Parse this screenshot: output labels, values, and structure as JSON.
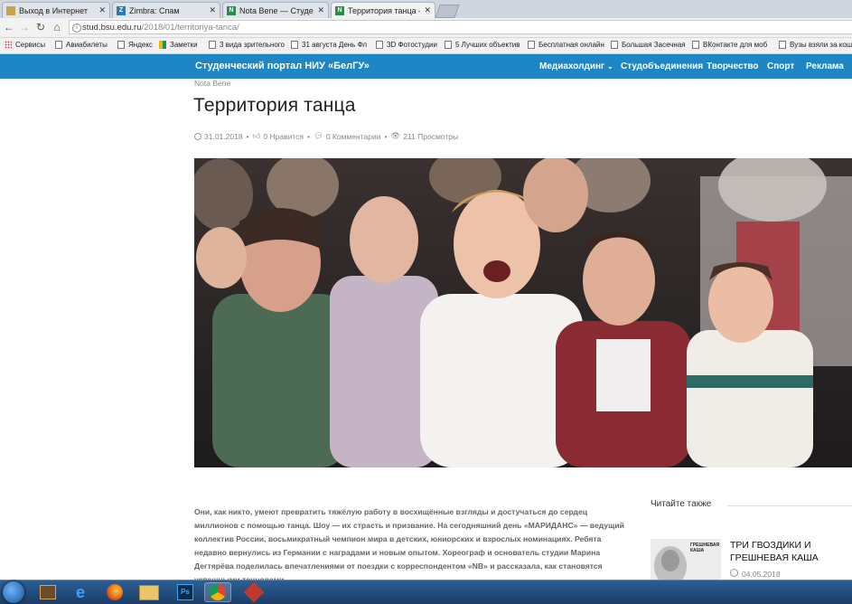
{
  "browser": {
    "tabs": [
      {
        "title": "Выход в Интернет",
        "favicon_color": "#c8a24a",
        "favicon_glyph": "",
        "active": false
      },
      {
        "title": "Zimbra: Спам",
        "favicon_color": "#2a7ab8",
        "favicon_glyph": "Z",
        "active": false
      },
      {
        "title": "Nota Bene — Студенческ",
        "favicon_color": "#2c8b4f",
        "favicon_glyph": "N",
        "active": false
      },
      {
        "title": "Территория танца — Сту",
        "favicon_color": "#2c8b4f",
        "favicon_glyph": "N",
        "active": true
      }
    ],
    "url_host": "stud.bsu.edu.ru",
    "url_path": "/2018/01/territoriya-tanca/",
    "bookmarks": [
      "Сервисы",
      "Авиабилеты",
      "Яндекс",
      "Заметки",
      "3 вида зрительного",
      "31 августа День Фл",
      "3D Фотостудии",
      "5 Лучших объектив",
      "Бесплатная онлайн",
      "Большая Засечная",
      "ВКонтакте для моб",
      "Вузы взяли за кошел"
    ]
  },
  "site": {
    "title": "Студенческий портал НИУ «БелГУ»",
    "menu": [
      "Медиахолдинг",
      "Студобъединения",
      "Творчество",
      "Спорт",
      "Реклама"
    ],
    "menu_chevron": "chevron-down-icon"
  },
  "article": {
    "category": "Nota Bene",
    "title": "Территория танца",
    "date": "31.01.2018",
    "likes": "0 Нравится",
    "comments": "0 Комментарии",
    "views": "211 Просмотры",
    "body": "Они, как никто, умеют превратить тяжёлую работу в восхищённые взгляды и достучаться до сердец миллионов с помощью танца. Шоу — их страсть и призвание. На сегодняшний день «МАРИДАНС» — ведущий коллектив России, восьмикратный чемпион мира в детских, юниорских и взрослых номинациях. Ребята недавно вернулись из Германии с наградами и новым опытом. Хореограф и основатель студии Марина Дегтярёва поделилась впечатлениями от поездки с корреспондентом «NB» и рассказала, как становятся успешными танцорами."
  },
  "sidebar": {
    "heading": "Читайте также",
    "related_title": "ТРИ ГВОЗДИКИ И ГРЕШНЕВАЯ КАША",
    "related_date": "04.05.2018",
    "thumb_caption": "ГРЕШНЕВАЯ КАША"
  },
  "colors": {
    "site_header": "#1f86c5"
  }
}
